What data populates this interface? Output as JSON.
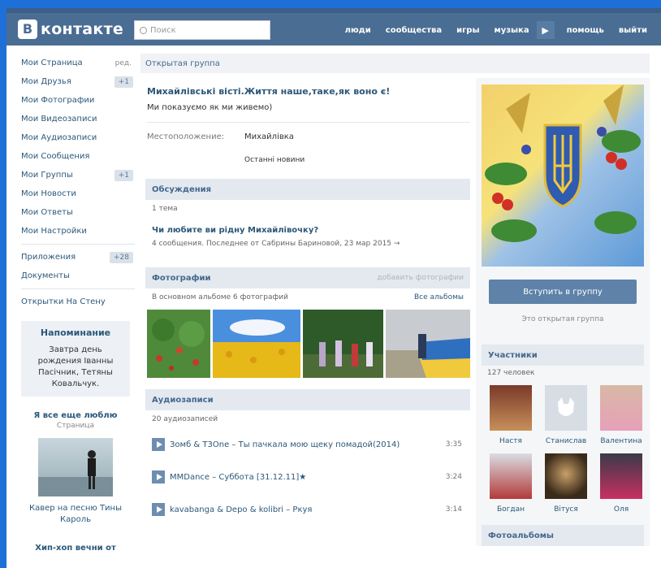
{
  "header": {
    "logo_letter": "В",
    "logo_text": "контакте",
    "search_placeholder": "Поиск",
    "nav": [
      "люди",
      "сообщества",
      "игры",
      "музыка",
      "помощь",
      "выйти"
    ]
  },
  "leftnav": {
    "items": [
      {
        "label": "Мои Страница",
        "extra": "ред."
      },
      {
        "label": "Мои Друзья",
        "badge": "+1"
      },
      {
        "label": "Мои Фотографии"
      },
      {
        "label": "Мои Видеозаписи"
      },
      {
        "label": "Мои Аудиозаписи"
      },
      {
        "label": "Мои Сообщения"
      },
      {
        "label": "Мои Группы",
        "badge": "+1"
      },
      {
        "label": "Мои Новости"
      },
      {
        "label": "Мои Ответы"
      },
      {
        "label": "Мои Настройки"
      }
    ],
    "apps": {
      "label": "Приложения",
      "badge": "+28"
    },
    "docs": "Документы",
    "cards": "Открытки На Стену",
    "reminder": {
      "title": "Напоминание",
      "text": "Завтра день рождения Іванны Пасічник, Тетяны Ковальчук."
    },
    "block": {
      "title": "Я все еще люблю",
      "sub": "Страница",
      "caption": "Кавер на песню Тины Кароль"
    },
    "bottom": "Хип-хоп вечни от"
  },
  "page": {
    "group_type": "Открытая группа",
    "title": "Михайлівські вісті.Життя наше,таке,як воно є!",
    "status": "Ми показуємо як ми живемо)",
    "location_label": "Местоположение:",
    "location_value": "Михайлівка",
    "latest_news": "Останні новини"
  },
  "discussions": {
    "title": "Обсуждения",
    "count": "1 тема",
    "topic_title": "Чи любите ви рідну Михайлівочку?",
    "topic_meta": "4 сообщения. Последнее от Сабрины Бариновой, 23 мар 2015"
  },
  "photos": {
    "title": "Фотографии",
    "add": "добавить фотографии",
    "count": "В основном альбоме 6 фотографий",
    "all": "Все альбомы"
  },
  "audio": {
    "title": "Аудиозаписи",
    "count": "20 аудиозаписей",
    "tracks": [
      {
        "title": "Зомб & T3One – Ты пачкала мою щеку помадой(2014)",
        "dur": "3:35"
      },
      {
        "title": "MMDance – Суббота [31.12.11]★",
        "dur": "3:24"
      },
      {
        "title": "kavabanga & Depo & kolibri – Ркуя",
        "dur": "3:14"
      }
    ]
  },
  "right": {
    "join": "Вступить в группу",
    "open": "Это открытая группа",
    "members_title": "Участники",
    "members_count": "127 человек",
    "members": [
      "Настя",
      "Станислав",
      "Валентина",
      "Богдан",
      "Вітуся",
      "Оля"
    ],
    "albums_title": "Фотоальбомы"
  },
  "colors": {
    "header": "#4a6d93",
    "link": "#2b587a",
    "section": "#e3e9ef",
    "border_blue": "#1e6fd8"
  }
}
